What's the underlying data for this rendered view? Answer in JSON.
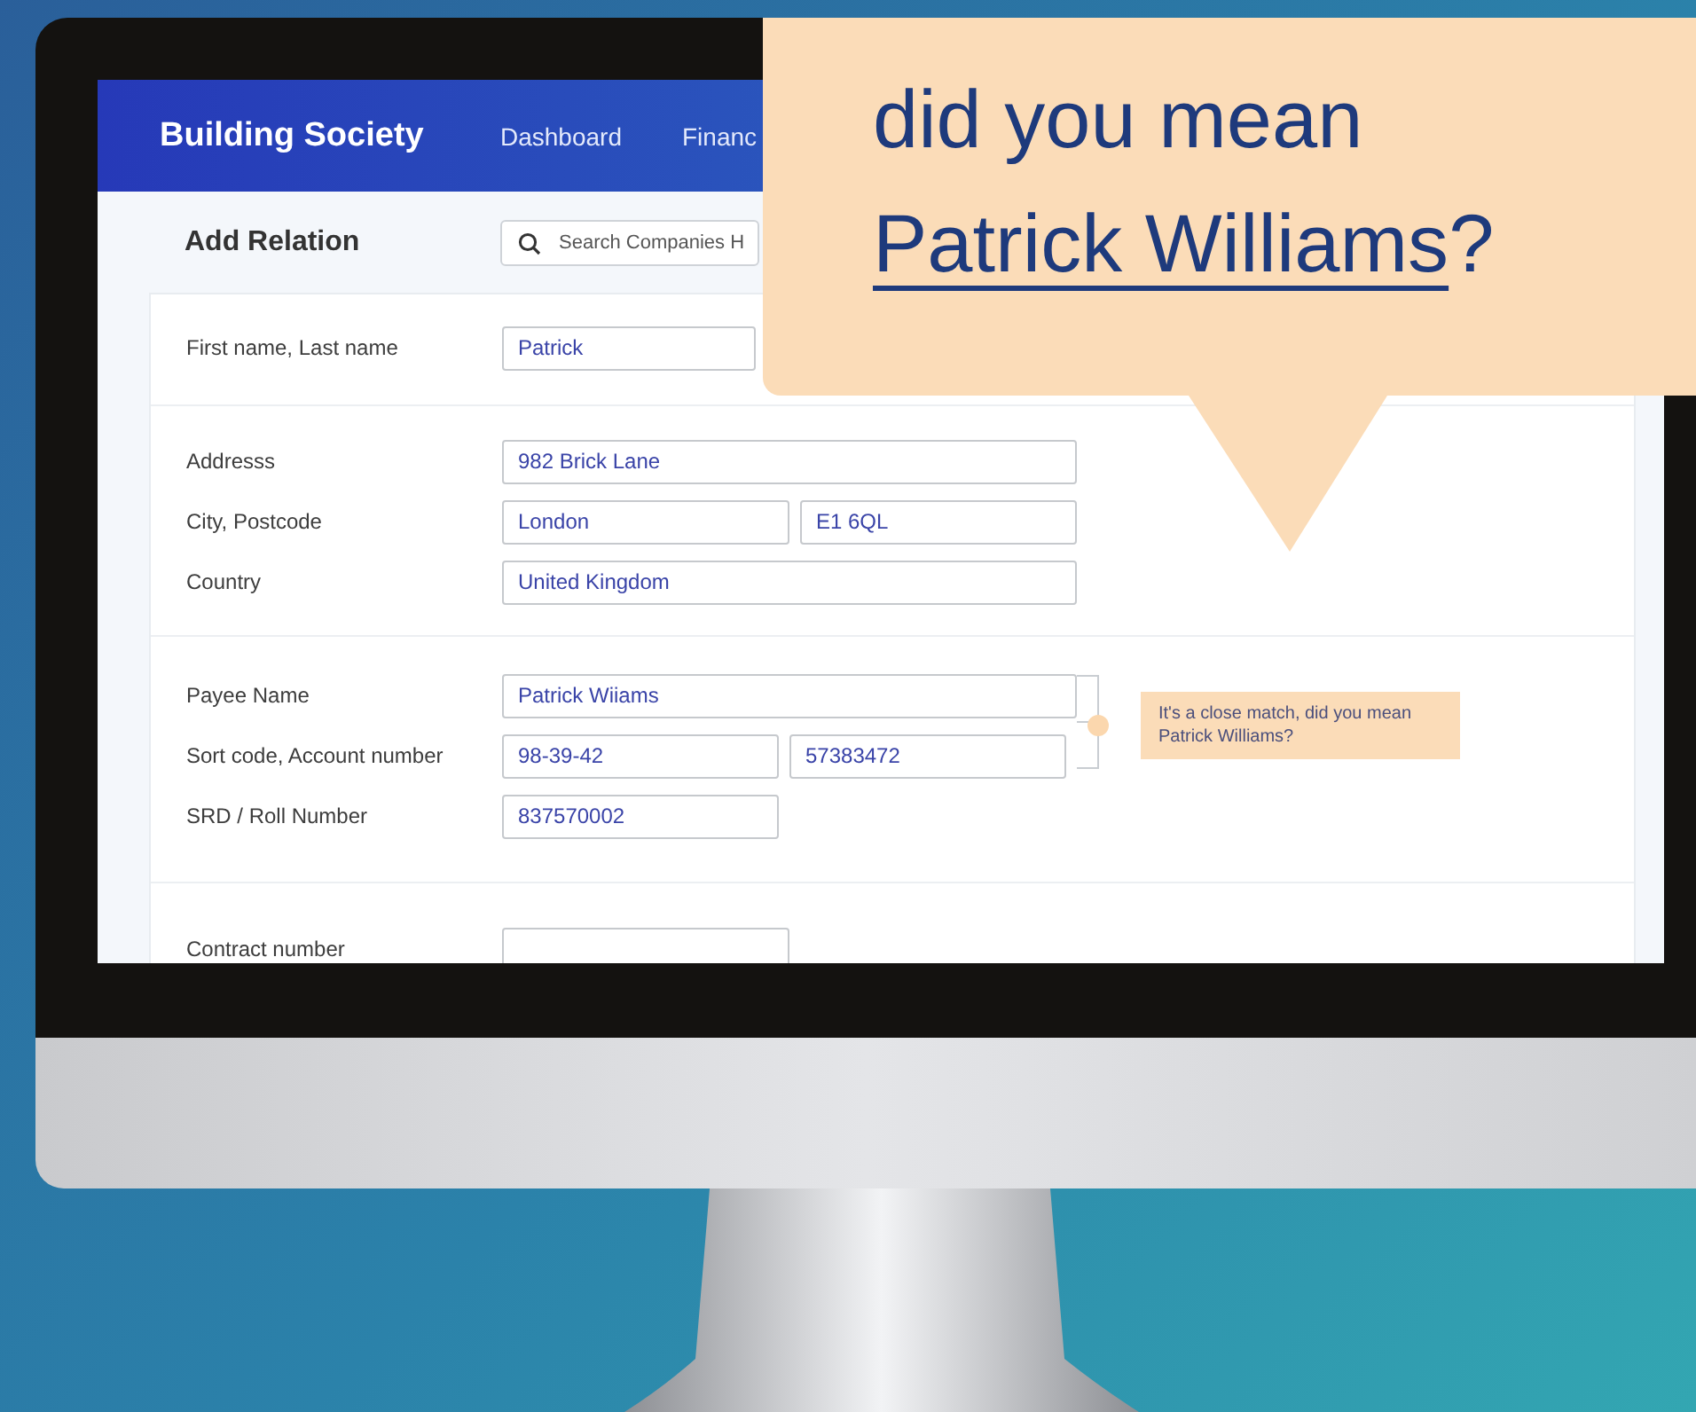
{
  "app": {
    "brand": "Building Society",
    "nav": [
      {
        "label": "Dashboard"
      },
      {
        "label": "Financ"
      }
    ]
  },
  "page_title": "Add Relation",
  "search": {
    "placeholder": "Search Companies H"
  },
  "form": {
    "sections": [
      {
        "rows": [
          {
            "kind": "partial",
            "label": "First name, Last name",
            "fields": [
              "Patrick"
            ]
          }
        ]
      },
      {
        "rows": [
          {
            "kind": "full",
            "label": "Addresss",
            "fields": [
              "982 Brick Lane"
            ]
          },
          {
            "kind": "pair",
            "label": "City, Postcode",
            "fields": [
              "London",
              "E1 6QL"
            ]
          },
          {
            "kind": "full",
            "label": "Country",
            "fields": [
              "United Kingdom"
            ]
          }
        ]
      },
      {
        "rows": [
          {
            "kind": "full",
            "label": "Payee Name",
            "fields": [
              "Patrick Wiiams"
            ]
          },
          {
            "kind": "pair",
            "label": "Sort code, Account number",
            "fields": [
              "98-39-42",
              "57383472"
            ]
          },
          {
            "kind": "short",
            "label": "SRD / Roll Number",
            "fields": [
              "837570002"
            ]
          }
        ],
        "hint": "It's a close match, did you mean Patrick Williams?"
      },
      {
        "rows": [
          {
            "kind": "blank",
            "label": "Contract number"
          }
        ]
      }
    ]
  },
  "callout": {
    "text": "did you mean",
    "link": "Patrick Williams",
    "suffix": "?"
  }
}
